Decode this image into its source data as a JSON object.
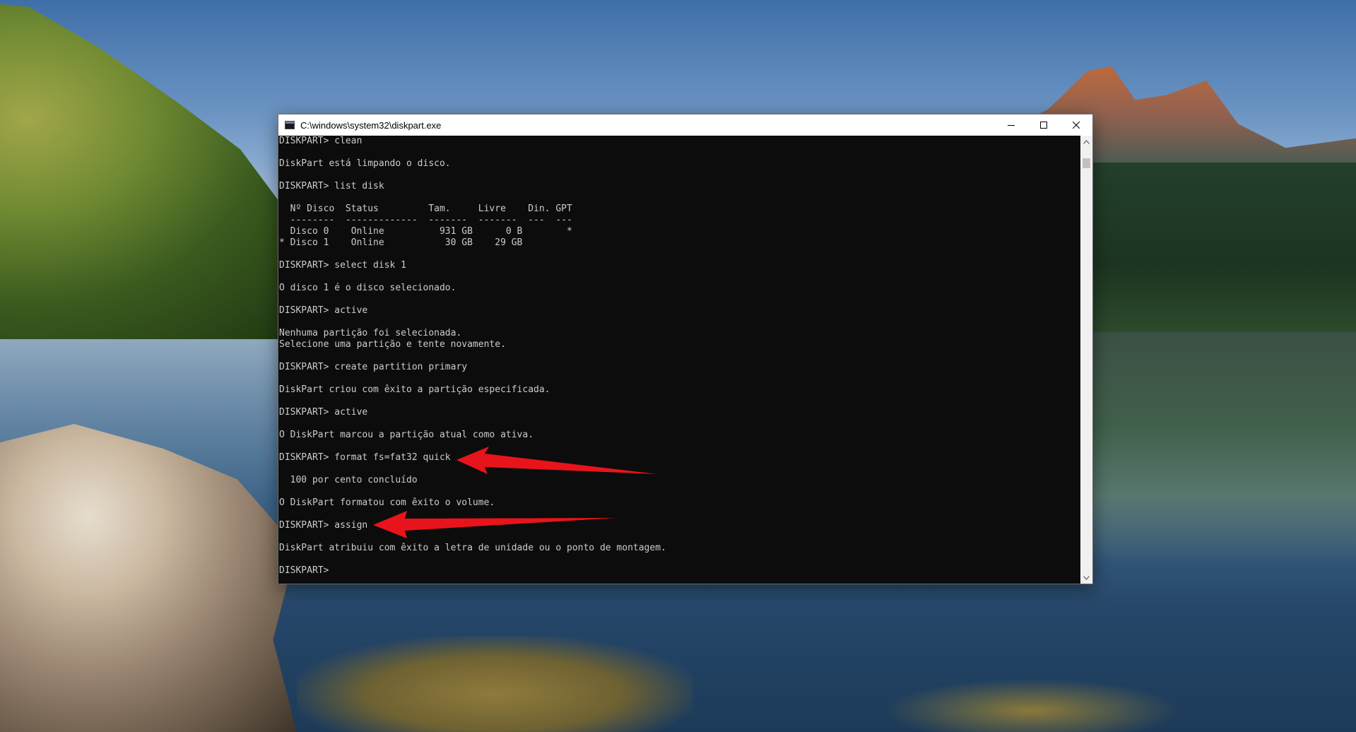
{
  "window": {
    "title": "C:\\windows\\system32\\diskpart.exe",
    "buttons": {
      "minimize": "minimize-icon",
      "maximize": "maximize-icon",
      "close": "close-icon"
    }
  },
  "console": {
    "lines": [
      "DISKPART> clean",
      "",
      "DiskPart está limpando o disco.",
      "",
      "DISKPART> list disk",
      "",
      "  Nº Disco  Status         Tam.     Livre    Din. GPT",
      "  --------  -------------  -------  -------  ---  ---",
      "  Disco 0    Online          931 GB      0 B        *",
      "* Disco 1    Online           30 GB    29 GB",
      "",
      "DISKPART> select disk 1",
      "",
      "O disco 1 é o disco selecionado.",
      "",
      "DISKPART> active",
      "",
      "Nenhuma partição foi selecionada.",
      "Selecione uma partição e tente novamente.",
      "",
      "DISKPART> create partition primary",
      "",
      "DiskPart criou com êxito a partição especificada.",
      "",
      "DISKPART> active",
      "",
      "O DiskPart marcou a partição atual como ativa.",
      "",
      "DISKPART> format fs=fat32 quick",
      "",
      "  100 por cento concluído",
      "",
      "O DiskPart formatou com êxito o volume.",
      "",
      "DISKPART> assign",
      "",
      "DiskPart atribuiu com êxito a letra de unidade ou o ponto de montagem.",
      "",
      "DISKPART> "
    ]
  },
  "annotations": {
    "arrow_color": "#e8141b",
    "arrows": [
      "arrow-to-format-command",
      "arrow-to-assign-command"
    ]
  },
  "colors": {
    "console_bg": "#0c0c0c",
    "console_fg": "#cccccc",
    "titlebar_bg": "#ffffff"
  }
}
